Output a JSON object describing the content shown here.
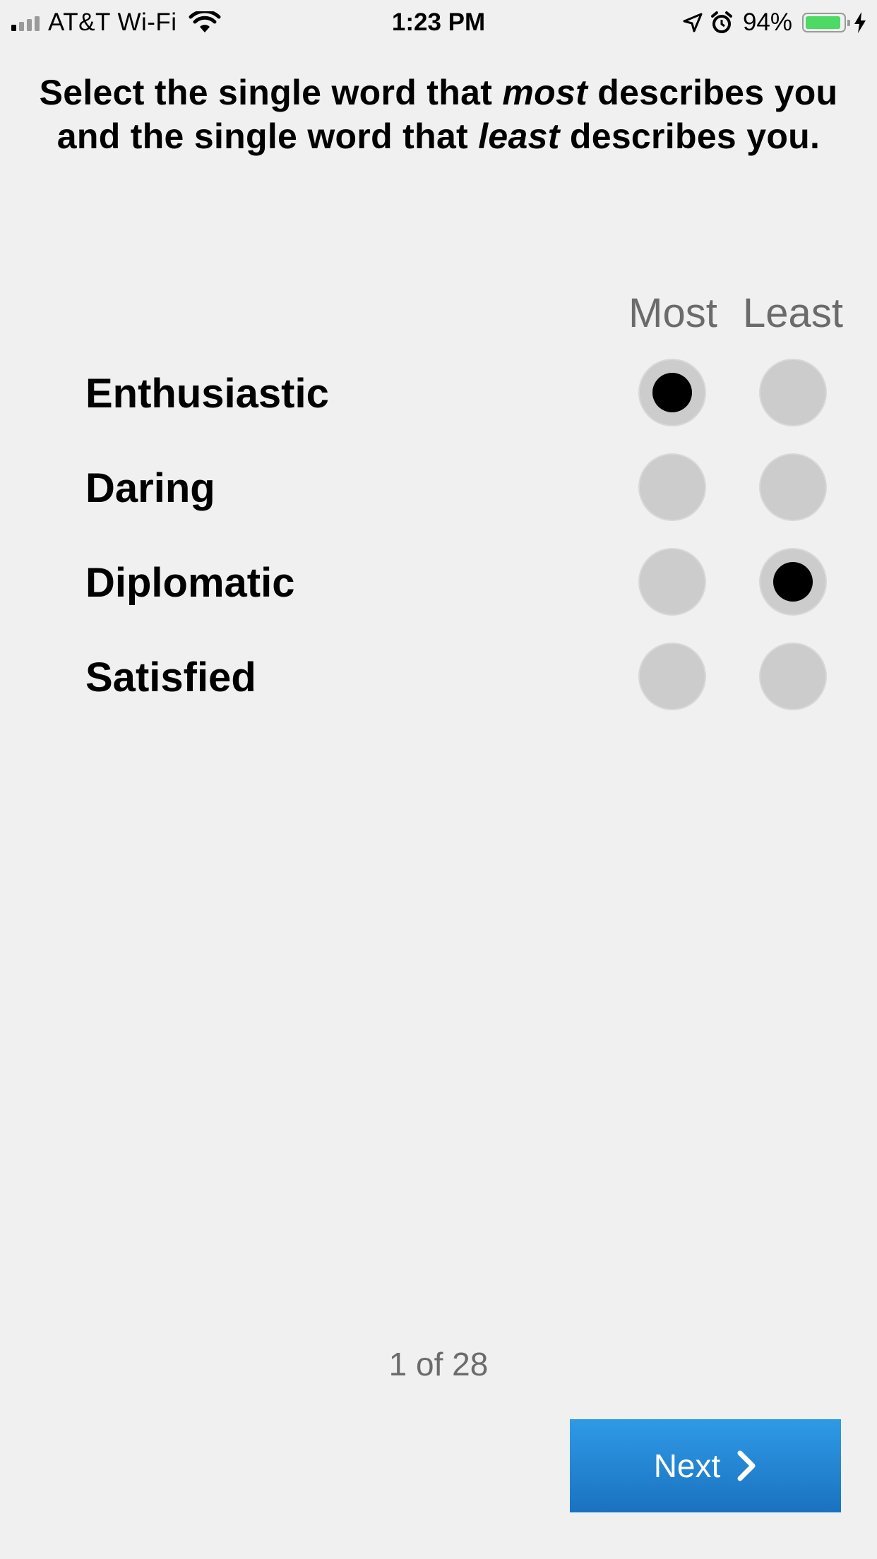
{
  "status_bar": {
    "carrier": "AT&T Wi-Fi",
    "time": "1:23 PM",
    "battery_percent": "94%",
    "battery_level": 0.94,
    "battery_color": "#4cd964",
    "icons": [
      "signal-icon",
      "wifi-icon",
      "location-icon",
      "alarm-icon",
      "battery-icon",
      "charging-icon"
    ]
  },
  "prompt": {
    "part1": "Select the single word that ",
    "emph1": "most",
    "part2": " describes you and the single word that ",
    "emph2": "least",
    "part3": " describes you."
  },
  "columns": {
    "most": "Most",
    "least": "Least"
  },
  "words": [
    {
      "label": "Enthusiastic",
      "most_selected": true,
      "least_selected": false
    },
    {
      "label": "Daring",
      "most_selected": false,
      "least_selected": false
    },
    {
      "label": "Diplomatic",
      "most_selected": false,
      "least_selected": true
    },
    {
      "label": "Satisfied",
      "most_selected": false,
      "least_selected": false
    }
  ],
  "pager": "1 of 28",
  "next_button": {
    "label": "Next",
    "icon": "chevron-right-icon"
  },
  "colors": {
    "background": "#f0f0f0",
    "accent": "#2a8ad8",
    "radio_fill": "#cccccc"
  }
}
